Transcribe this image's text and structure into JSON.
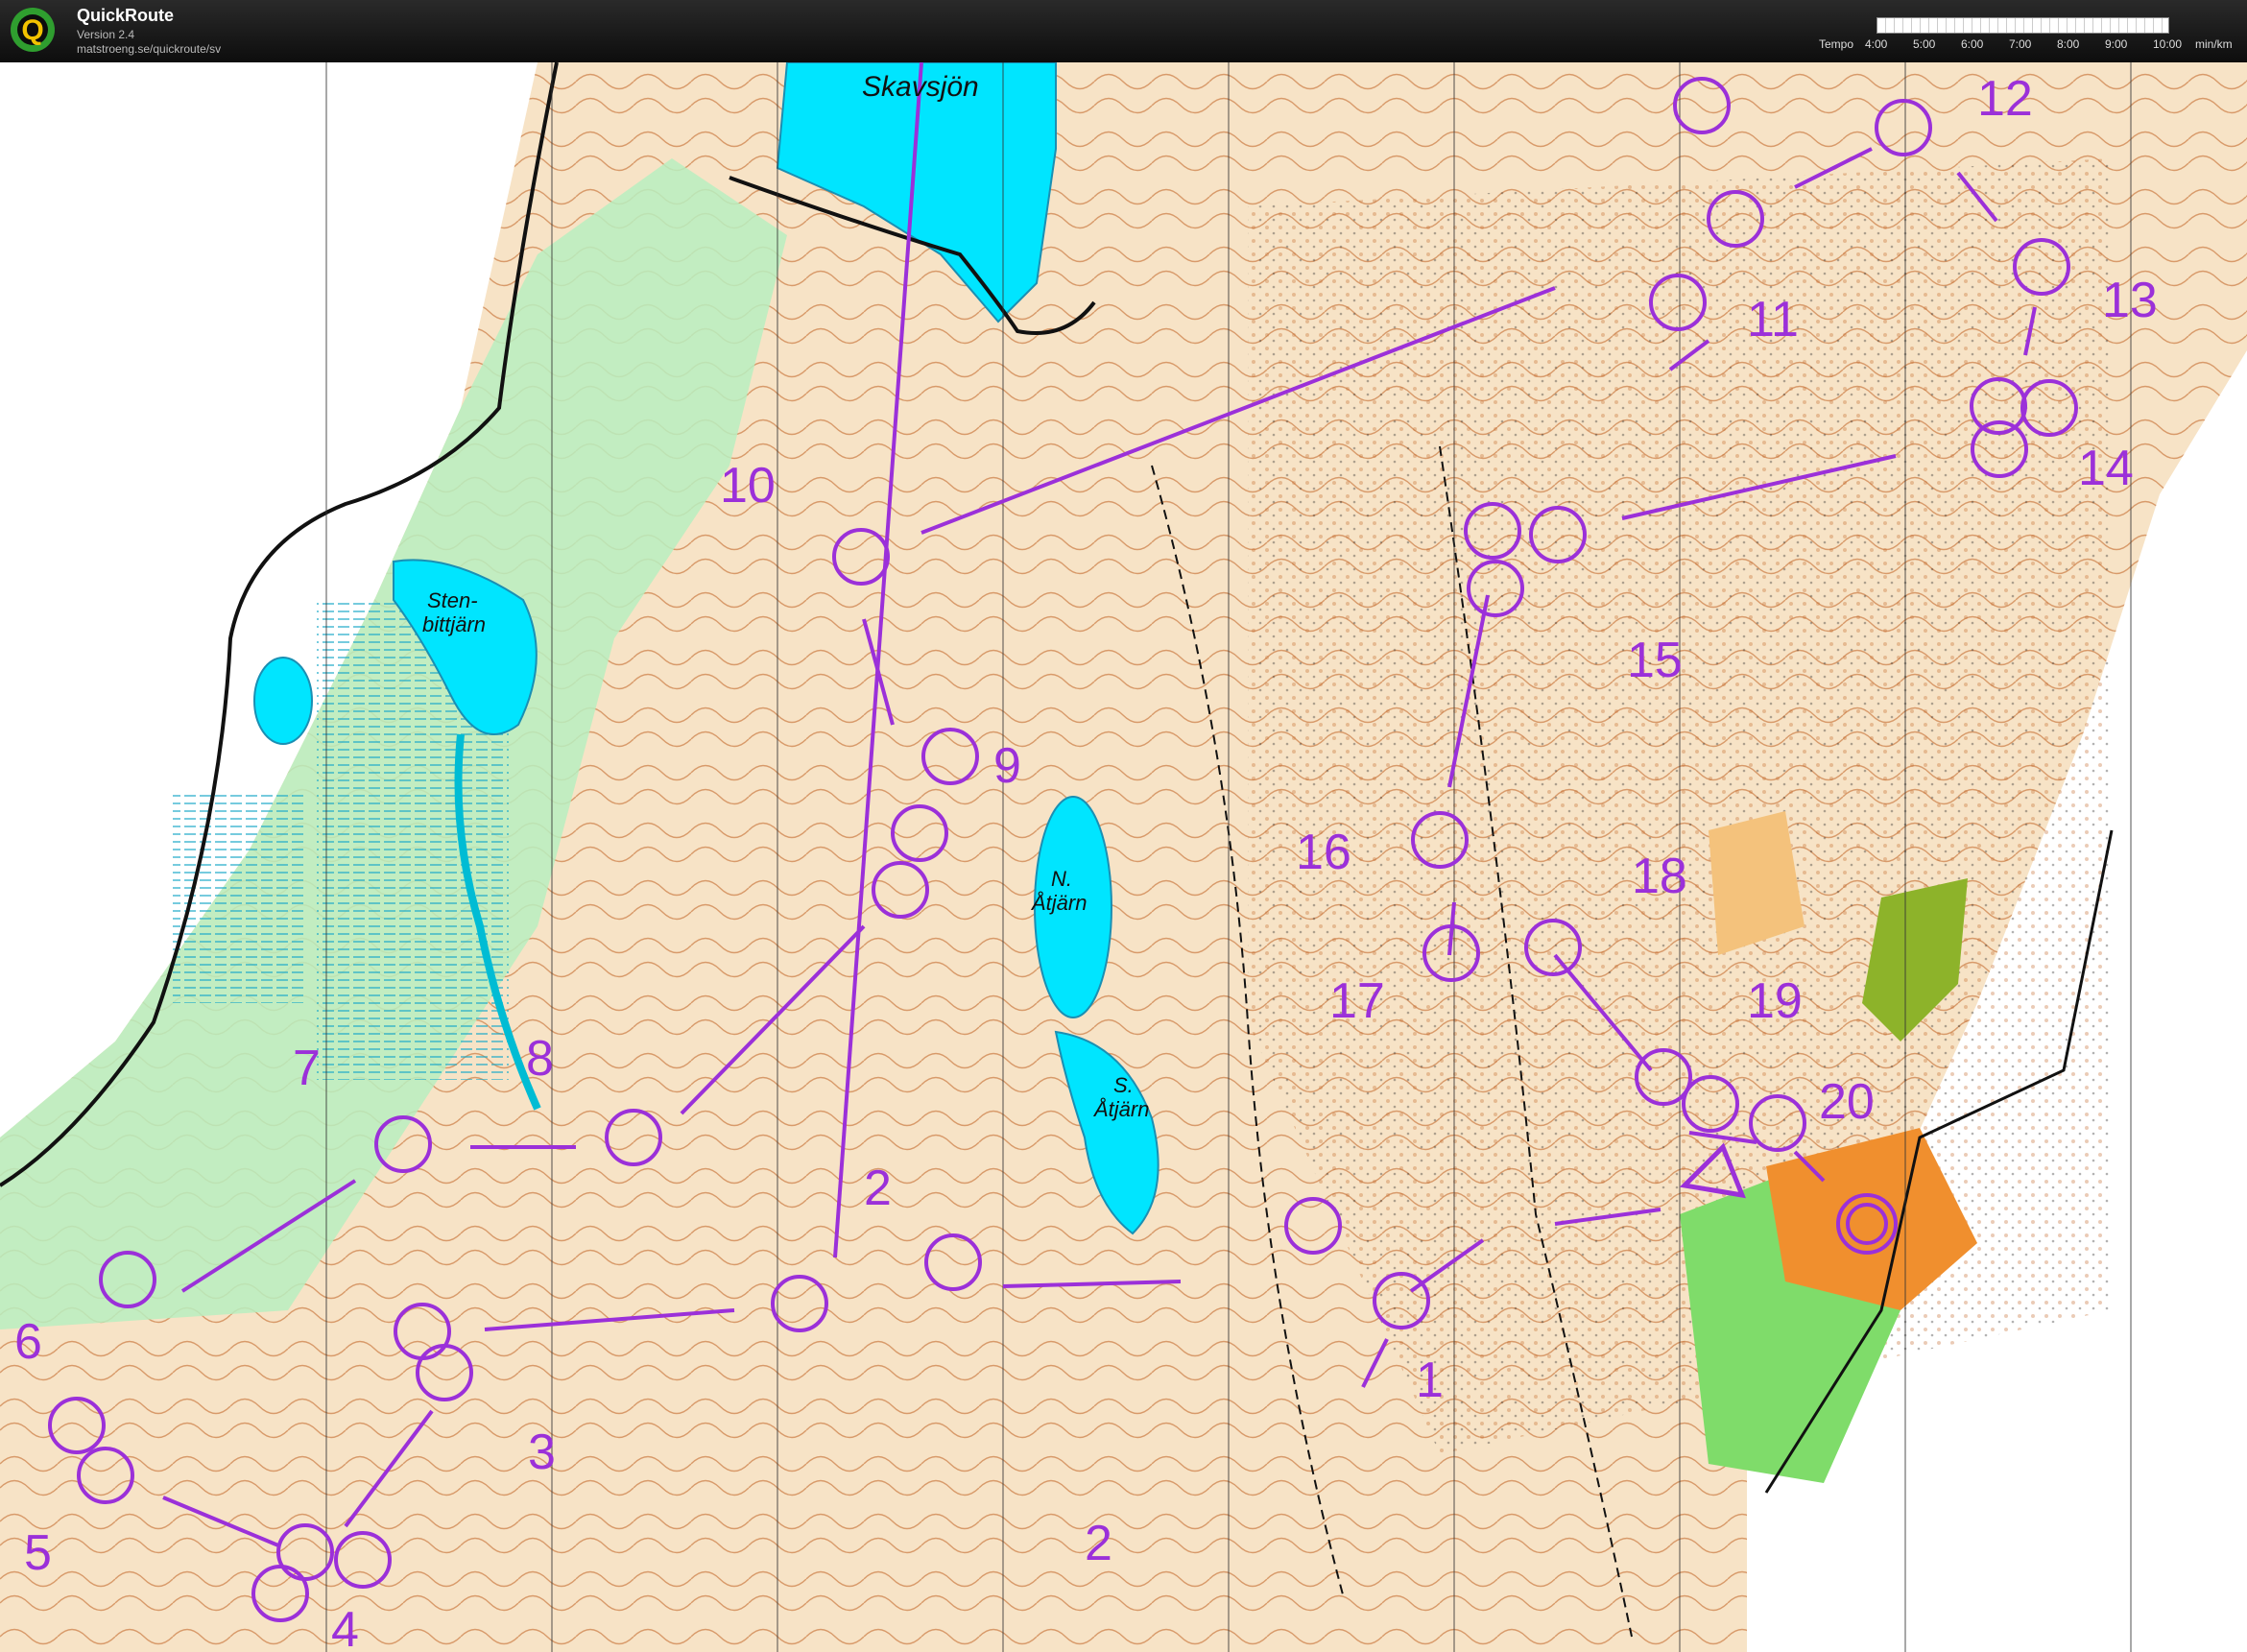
{
  "app": {
    "name": "QuickRoute",
    "version": "Version 2.4",
    "url": "matstroeng.se/quickroute/sv",
    "logo_letter": "Q"
  },
  "tempo": {
    "label": "Tempo",
    "ticks": [
      "4:00",
      "5:00",
      "6:00",
      "7:00",
      "8:00",
      "9:00",
      "10:00"
    ],
    "unit": "min/km"
  },
  "map": {
    "place_names": {
      "skavsjon": "Skavsjön",
      "stenbittjarn_1": "Sten-",
      "stenbittjarn_2": "bittjärn",
      "n_atjarn_1": "N.",
      "n_atjarn_2": "Åtjärn",
      "s_atjarn_1": "S.",
      "s_atjarn_2": "Åtjärn"
    },
    "control_numbers": [
      "1",
      "2",
      "2",
      "3",
      "4",
      "5",
      "6",
      "7",
      "8",
      "9",
      "10",
      "11",
      "12",
      "13",
      "14",
      "15",
      "16",
      "17",
      "18",
      "19",
      "20"
    ],
    "colors": {
      "course": "#9b30d9",
      "water": "#00e5ff",
      "terrain": "#f4d3a2",
      "vegetation": "#8fe39a",
      "contour": "#c36a2d",
      "road": "#111111"
    }
  }
}
